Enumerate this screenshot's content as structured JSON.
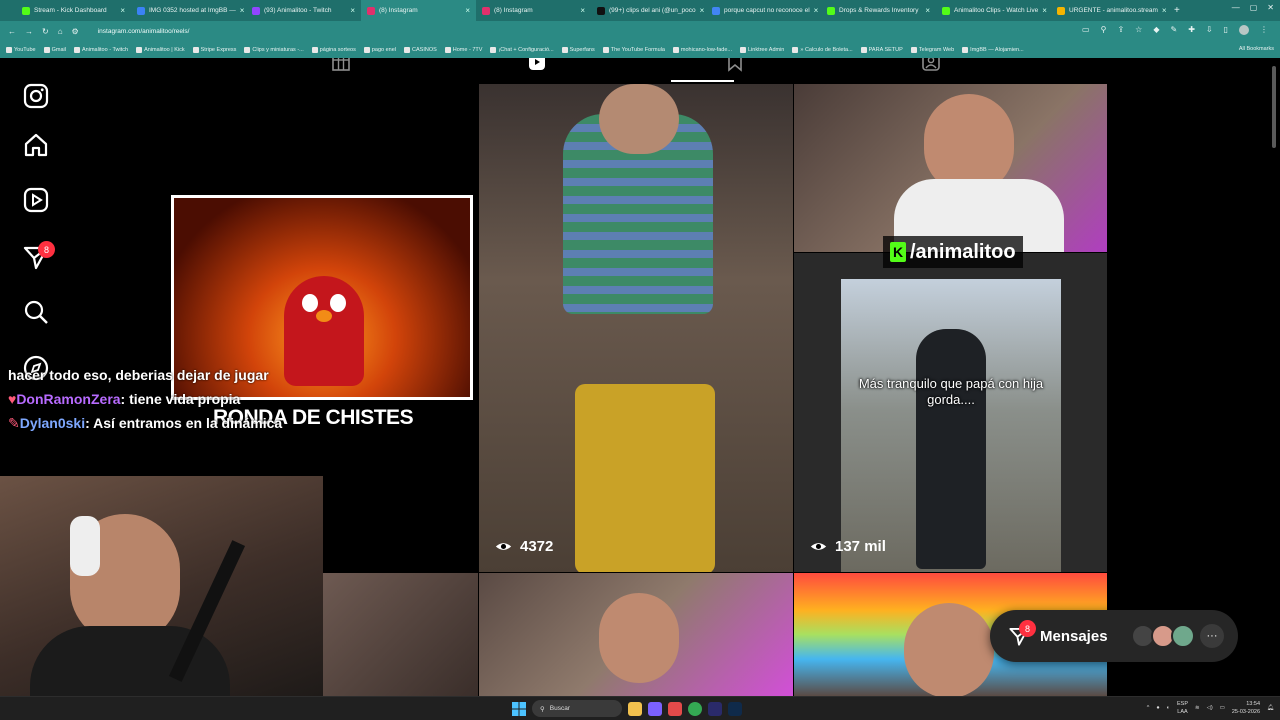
{
  "browser": {
    "tabs": [
      {
        "title": "Stream - Kick Dashboard",
        "color": "#53fc18"
      },
      {
        "title": "IMG 0352 hosted at ImgBB —",
        "color": "#3b82f6"
      },
      {
        "title": "(93) Animalitoo - Twitch",
        "color": "#9146ff"
      },
      {
        "title": "(8) Instagram",
        "color": "#e1306c",
        "active": true
      },
      {
        "title": "(8) Instagram",
        "color": "#e1306c"
      },
      {
        "title": "(99+) clips del ani (@un_poco",
        "color": "#111111"
      },
      {
        "title": "porque capcut no reconoce el",
        "color": "#4285f4"
      },
      {
        "title": "Drops & Rewards Inventory",
        "color": "#53fc18"
      },
      {
        "title": "Animalitoo Clips - Watch Live",
        "color": "#53fc18"
      },
      {
        "title": "URGENTE - animalitoo.stream",
        "color": "#f4b400"
      }
    ],
    "url": "instagram.com/animalitoo/reels/",
    "bookmarks": [
      "YouTube",
      "Gmail",
      "Animalitoo - Twitch",
      "Animalitoo | Kick",
      "Stripe Express",
      "Clips y miniaturas -...",
      "página sorteos",
      "pago enel",
      "CASINOS",
      "Home - 7TV",
      "¡Chat + Configuració...",
      "Superfans",
      "The YouTube Formula",
      "mohicano-low-fade...",
      "Linktree Admin",
      "» Calculo de Boleta...",
      "PARA SETUP",
      "Telegram Web",
      "ImgBB — Alojamien..."
    ],
    "all_bookmarks": "All Bookmarks"
  },
  "sidebar": {
    "notifications_badge": "8"
  },
  "grid": {
    "tile_views": [
      "4372",
      "137 mil"
    ],
    "kick_handle": "/animalitoo",
    "caption": "Más tranquilo que papá con hija gorda...."
  },
  "stream_overlay": {
    "segment_title": "RONDA DE CHISTES",
    "chat": [
      {
        "user": "",
        "text": "hacer todo eso, deberias dejar de jugar"
      },
      {
        "user": "DonRamonZera",
        "text": ": tiene vida propia"
      },
      {
        "user": "Dylan0ski",
        "text": ": Así entramos en la dinámica"
      }
    ]
  },
  "messages": {
    "label": "Mensajes",
    "badge": "8",
    "more": "···"
  },
  "taskbar": {
    "search_placeholder": "Buscar",
    "lang_top": "ESP",
    "lang_bottom": "LAA",
    "time": "13:54",
    "date": "25-03-2026"
  },
  "colors": {
    "chrome": "#2b8a84",
    "tabstrip": "#1f6f6b",
    "kick_green": "#53fc18",
    "ig_badge": "#ff3040"
  }
}
